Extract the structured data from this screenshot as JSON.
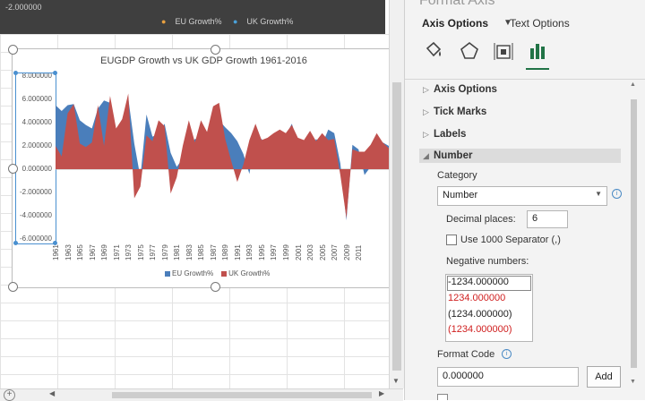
{
  "top_chart": {
    "y_value": "-2.000000",
    "legend": [
      "EU Growth%",
      "UK Growth%"
    ]
  },
  "chart_data": {
    "type": "area",
    "title": "EUGDP  Growth vs UK GDP Growth 1961-2016",
    "ylim": [
      -6,
      8
    ],
    "y_ticks": [
      "8.000000",
      "6.000000",
      "4.000000",
      "2.000000",
      "0.000000",
      "-2.000000",
      "-4.000000",
      "-6.000000"
    ],
    "x_ticks": [
      "1961",
      "1963",
      "1965",
      "1967",
      "1969",
      "1971",
      "1973",
      "1975",
      "1977",
      "1979",
      "1981",
      "1983",
      "1985",
      "1987",
      "1989",
      "1991",
      "1993",
      "1995",
      "1997",
      "1999",
      "2001",
      "2003",
      "2005",
      "2007",
      "2009",
      "2011"
    ],
    "grid": false,
    "legend_position": "bottom",
    "series": [
      {
        "name": "EU Growth%",
        "color": "#4a7ebb",
        "x": [
          1961,
          1962,
          1963,
          1964,
          1965,
          1966,
          1967,
          1968,
          1969,
          1970,
          1971,
          1972,
          1973,
          1974,
          1975,
          1976,
          1977,
          1978,
          1979,
          1980,
          1981,
          1982,
          1983,
          1984,
          1985,
          1986,
          1987,
          1988,
          1989,
          1990,
          1991,
          1992,
          1993,
          1994,
          1995,
          1996,
          1997,
          1998,
          1999,
          2000,
          2001,
          2002,
          2003,
          2004,
          2005,
          2006,
          2007,
          2008,
          2009,
          2010,
          2011,
          2012,
          2013,
          2014,
          2015,
          2016
        ],
        "values": [
          5.5,
          5.0,
          5.5,
          5.6,
          4.2,
          3.8,
          3.5,
          5.2,
          5.9,
          5.7,
          3.3,
          4.3,
          6.1,
          2.2,
          -0.7,
          4.7,
          2.8,
          3.0,
          3.9,
          1.4,
          0.2,
          0.9,
          1.8,
          2.6,
          2.6,
          2.9,
          3.0,
          4.2,
          3.6,
          3.1,
          2.4,
          1.3,
          -0.4,
          2.8,
          2.6,
          1.7,
          2.7,
          2.9,
          2.9,
          3.9,
          2.2,
          1.3,
          1.4,
          2.6,
          2.1,
          3.4,
          3.1,
          0.5,
          -4.4,
          2.1,
          1.7,
          -0.5,
          0.2,
          1.6,
          2.3,
          2.0
        ]
      },
      {
        "name": "UK Growth%",
        "color": "#c0504d",
        "x": [
          1961,
          1962,
          1963,
          1964,
          1965,
          1966,
          1967,
          1968,
          1969,
          1970,
          1971,
          1972,
          1973,
          1974,
          1975,
          1976,
          1977,
          1978,
          1979,
          1980,
          1981,
          1982,
          1983,
          1984,
          1985,
          1986,
          1987,
          1988,
          1989,
          1990,
          1991,
          1992,
          1993,
          1994,
          1995,
          1996,
          1997,
          1998,
          1999,
          2000,
          2001,
          2002,
          2003,
          2004,
          2005,
          2006,
          2007,
          2008,
          2009,
          2010,
          2011,
          2012,
          2013,
          2014,
          2015,
          2016
        ],
        "values": [
          2.0,
          1.1,
          4.8,
          5.6,
          2.2,
          1.9,
          2.3,
          5.5,
          2.0,
          6.3,
          3.5,
          4.3,
          6.5,
          -2.5,
          -1.5,
          2.9,
          2.4,
          4.2,
          3.7,
          -2.1,
          -0.7,
          2.0,
          4.2,
          2.3,
          4.2,
          3.2,
          5.4,
          5.7,
          2.6,
          0.7,
          -1.1,
          0.4,
          2.5,
          3.9,
          2.5,
          2.7,
          3.1,
          3.4,
          3.1,
          3.8,
          2.7,
          2.5,
          3.3,
          2.4,
          3.1,
          2.5,
          2.6,
          -0.5,
          -4.2,
          1.7,
          1.5,
          1.5,
          2.1,
          3.1,
          2.3,
          1.8
        ]
      }
    ]
  },
  "format_pane": {
    "title": "Format Axis",
    "tabs": {
      "active": "Axis Options",
      "inactive": "Text Options"
    },
    "icons": [
      "fill-line-icon",
      "effects-icon",
      "size-properties-icon",
      "axis-options-icon"
    ],
    "sections": {
      "axis_options": "Axis Options",
      "tick_marks": "Tick Marks",
      "labels": "Labels",
      "number": "Number"
    },
    "category_label": "Category",
    "category_value": "Number",
    "decimal_label": "Decimal places:",
    "decimal_value": "6",
    "separator_label": "Use 1000 Separator (,)",
    "negative_label": "Negative numbers:",
    "negative_options": [
      {
        "text": "-1234.000000",
        "color": "#222222"
      },
      {
        "text": "1234.000000",
        "color": "#d02020"
      },
      {
        "text": "(1234.000000)",
        "color": "#222222"
      },
      {
        "text": "(1234.000000)",
        "color": "#d02020"
      }
    ],
    "format_code_label": "Format Code",
    "format_code_value": "0.000000",
    "add_label": "Add"
  },
  "sheet_controls": {
    "add_sheet": "+"
  }
}
